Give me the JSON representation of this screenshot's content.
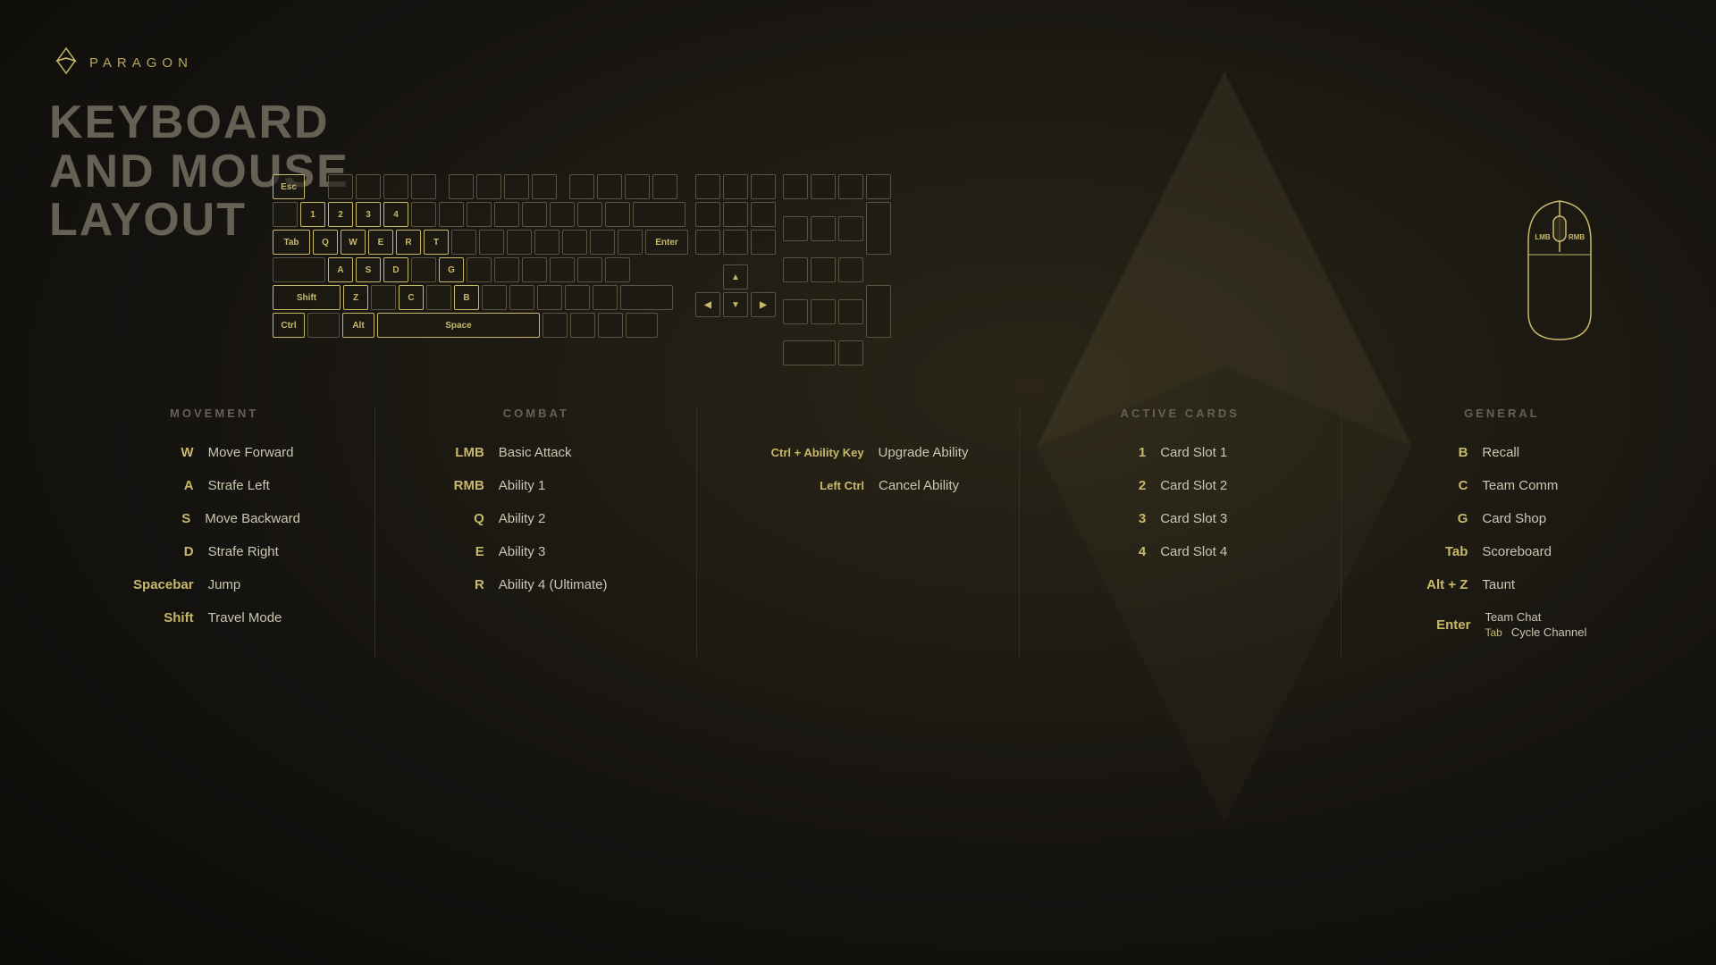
{
  "logo": {
    "text": "PARAGON"
  },
  "title": {
    "line1": "KEYBOARD",
    "line2": "AND MOUSE",
    "line3": "LAYOUT"
  },
  "keyboard": {
    "highlighted_keys": [
      "W",
      "A",
      "S",
      "D",
      "Q",
      "E",
      "R",
      "T",
      "G",
      "B",
      "C",
      "Z",
      "1",
      "2",
      "3",
      "4",
      "Esc",
      "Tab",
      "Shift",
      "Ctrl",
      "Alt",
      "Space",
      "Enter"
    ]
  },
  "sections": {
    "movement": {
      "title": "MOVEMENT",
      "bindings": [
        {
          "key": "W",
          "action": "Move Forward"
        },
        {
          "key": "A",
          "action": "Strafe Left"
        },
        {
          "key": "S",
          "action": "Move Backward"
        },
        {
          "key": "D",
          "action": "Strafe Right"
        },
        {
          "key": "Spacebar",
          "action": "Jump"
        },
        {
          "key": "Shift",
          "action": "Travel Mode"
        }
      ]
    },
    "combat": {
      "title": "COMBAT",
      "bindings": [
        {
          "key": "LMB",
          "action": "Basic Attack"
        },
        {
          "key": "RMB",
          "action": "Ability 1"
        },
        {
          "key": "Q",
          "action": "Ability 2"
        },
        {
          "key": "E",
          "action": "Ability 3"
        },
        {
          "key": "R",
          "action": "Ability 4 (Ultimate)"
        }
      ]
    },
    "combat_combo": {
      "bindings": [
        {
          "key": "Ctrl + Ability Key",
          "action": "Upgrade Ability"
        },
        {
          "key": "Left Ctrl",
          "action": "Cancel Ability"
        }
      ]
    },
    "active_cards": {
      "title": "ACTIVE CARDS",
      "bindings": [
        {
          "key": "1",
          "action": "Card Slot 1"
        },
        {
          "key": "2",
          "action": "Card Slot 2"
        },
        {
          "key": "3",
          "action": "Card Slot 3"
        },
        {
          "key": "4",
          "action": "Card Slot 4"
        }
      ]
    },
    "general": {
      "title": "GENERAL",
      "bindings": [
        {
          "key": "B",
          "action": "Recall"
        },
        {
          "key": "C",
          "action": "Team Comm"
        },
        {
          "key": "G",
          "action": "Card Shop"
        },
        {
          "key": "Tab",
          "action": "Scoreboard"
        },
        {
          "key": "Alt + Z",
          "action": "Taunt"
        },
        {
          "key": "Enter",
          "action": "Team Chat"
        },
        {
          "key_sub": "Tab",
          "action_sub": "Cycle Channel"
        }
      ]
    }
  }
}
